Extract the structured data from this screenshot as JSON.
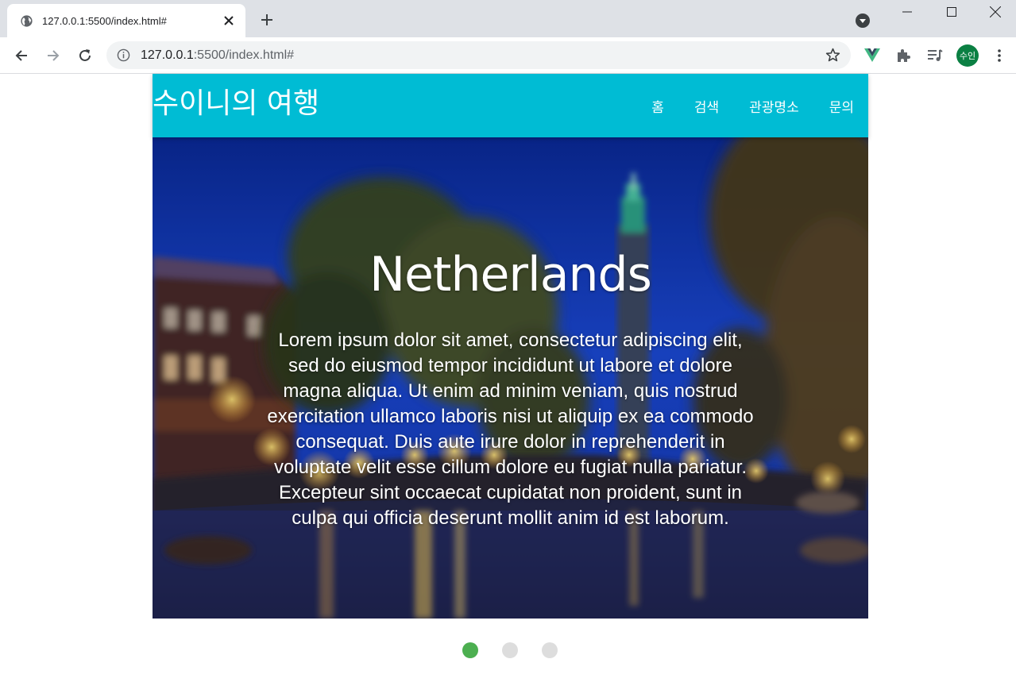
{
  "browser": {
    "tab": {
      "title": "127.0.0.1:5500/index.html#"
    },
    "address_bar": {
      "host": "127.0.0.1",
      "rest": ":5500/index.html#"
    },
    "profile": {
      "initials": "수인",
      "color": "#0b8043"
    }
  },
  "site": {
    "logo": "수이니의 여행",
    "header_color": "#00bcd4",
    "nav": [
      {
        "label": "홈"
      },
      {
        "label": "검색"
      },
      {
        "label": "관광명소"
      },
      {
        "label": "문의"
      }
    ]
  },
  "hero": {
    "title": "Netherlands",
    "body": "Lorem ipsum dolor sit amet, consectetur adipiscing elit, sed do eiusmod tempor incididunt ut labore et dolore magna aliqua. Ut enim ad minim veniam, quis nostrud exercitation ullamco laboris nisi ut aliquip ex ea commodo consequat. Duis aute irure dolor in reprehenderit in voluptate velit esse cillum dolore eu fugiat nulla pariatur. Excepteur sint occaecat cupidatat non proident, sunt in culpa qui officia deserunt mollit anim id est laborum."
  },
  "slider": {
    "active_color": "#4caf50",
    "inactive_color": "#dddddd",
    "dots": [
      {
        "active": true
      },
      {
        "active": false
      },
      {
        "active": false
      }
    ]
  }
}
